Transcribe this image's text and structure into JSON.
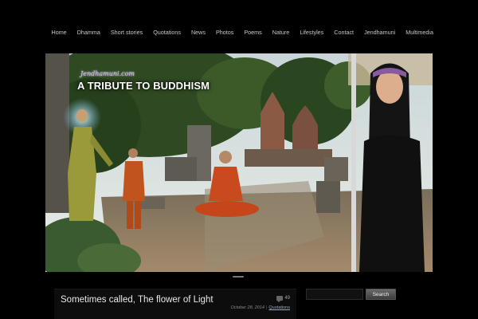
{
  "nav": {
    "items": [
      "Home",
      "Dhamma",
      "Short stories",
      "Quotations",
      "News",
      "Photos",
      "Poems",
      "Nature",
      "Lifestyles",
      "Contact",
      "Jendhamuni",
      "Multimedia"
    ]
  },
  "banner": {
    "site_name": "Jendhamuni.com",
    "title": "A TRIBUTE TO BUDDHISM"
  },
  "post": {
    "title": "Sometimes called, The flower of Light",
    "comment_count": "49",
    "date": "October 28, 2014",
    "separator": "|",
    "category": "Quotations"
  },
  "search": {
    "placeholder": "",
    "button_label": "Search"
  }
}
